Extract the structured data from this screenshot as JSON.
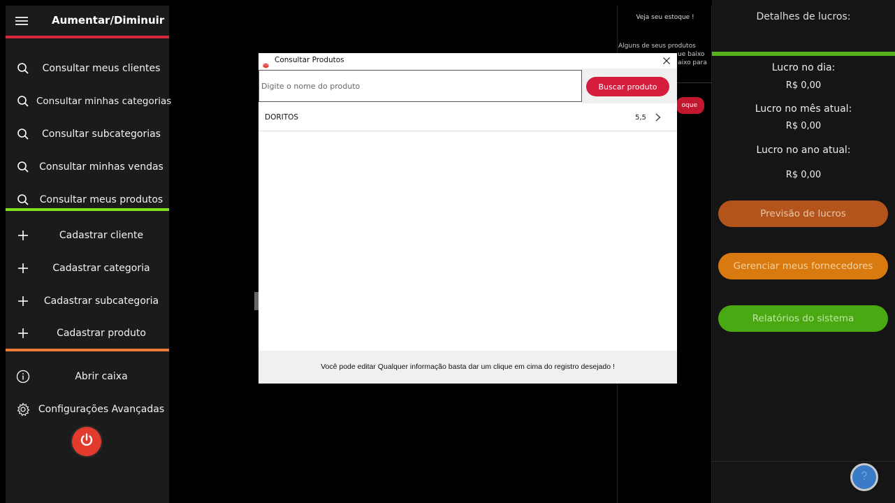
{
  "sidebar": {
    "title": "Aumentar/Diminuir",
    "bar_colors": {
      "top": "#d8283c",
      "middle": "#7fe01e",
      "bottom": "#f07a3a"
    },
    "search_items": [
      {
        "label": "Consultar meus clientes",
        "icon": "search-icon"
      },
      {
        "label": "Consultar minhas categorias",
        "icon": "search-icon"
      },
      {
        "label": "Consultar subcategorias",
        "icon": "search-icon"
      },
      {
        "label": "Consultar minhas vendas",
        "icon": "search-icon"
      },
      {
        "label": "Consultar meus produtos",
        "icon": "search-icon"
      }
    ],
    "add_items": [
      {
        "label": "Cadastrar cliente",
        "icon": "plus-icon"
      },
      {
        "label": "Cadastrar categoria",
        "icon": "plus-icon"
      },
      {
        "label": "Cadastrar subcategoria",
        "icon": "plus-icon"
      },
      {
        "label": "Cadastrar produto",
        "icon": "plus-icon"
      }
    ],
    "other_items": [
      {
        "label": "Abrir caixa",
        "icon": "info-icon"
      },
      {
        "label": "Configurações Avançadas",
        "icon": "gear-icon"
      }
    ]
  },
  "stock": {
    "title": "Veja seu estoque !",
    "line1": "Alguns de seus produtos",
    "line2": "ue baixo",
    "line3": "aixo para",
    "button": "oque"
  },
  "profit": {
    "title": "Detalhes de lucros:",
    "day_label": "Lucro no dia:",
    "day_value": "R$ 0,00",
    "month_label": "Lucro no mês atual:",
    "month_value": "R$ 0,00",
    "year_label": "Lucro no ano atual:",
    "year_value": "R$ 0,00",
    "btn_forecast": "Previsão de lucros",
    "btn_suppliers": "Gerenciar meus fornecedores",
    "btn_reports": "Relatórios do sistema",
    "colors": {
      "forecast": "#b3541c",
      "suppliers": "#d97a10",
      "reports": "#4aa812"
    }
  },
  "modal": {
    "title": "Consultar Produtos",
    "search_placeholder": "Digite o nome do produto",
    "search_button": "Buscar produto",
    "results": [
      {
        "name": "DORITOS",
        "value": "5,5"
      }
    ],
    "footer": "Você pode editar Qualquer informação basta dar um clique em cima do registro desejado !"
  }
}
